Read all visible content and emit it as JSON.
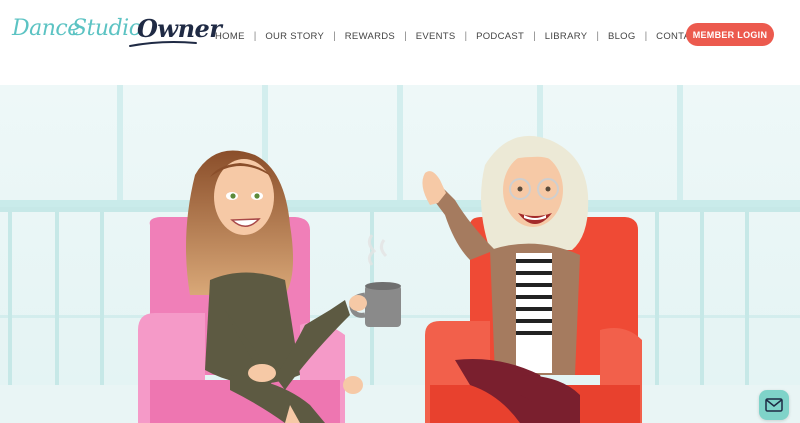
{
  "logo": {
    "part1": "Dance",
    "part2": "Studio",
    "part3": "Owner"
  },
  "nav": {
    "items": [
      {
        "label": "HOME"
      },
      {
        "label": "OUR STORY"
      },
      {
        "label": "REWARDS"
      },
      {
        "label": "EVENTS"
      },
      {
        "label": "PODCAST"
      },
      {
        "label": "LIBRARY"
      },
      {
        "label": "BLOG"
      },
      {
        "label": "CONTACT"
      }
    ],
    "separator": "|"
  },
  "member_login": {
    "label": "MEMBER LOGIN"
  },
  "hero": {
    "illustration": "two cartoon women seated in armchairs, one holding a coffee mug, one waving"
  },
  "colors": {
    "brand_teal": "#5cc3c3",
    "brand_navy": "#1f2a44",
    "button_red": "#ec5a4e",
    "chat_teal": "#7fd3c9",
    "pink_chair": "#f07fb8",
    "red_chair": "#ef4a35"
  },
  "icons": {
    "chat": "mail-icon"
  }
}
